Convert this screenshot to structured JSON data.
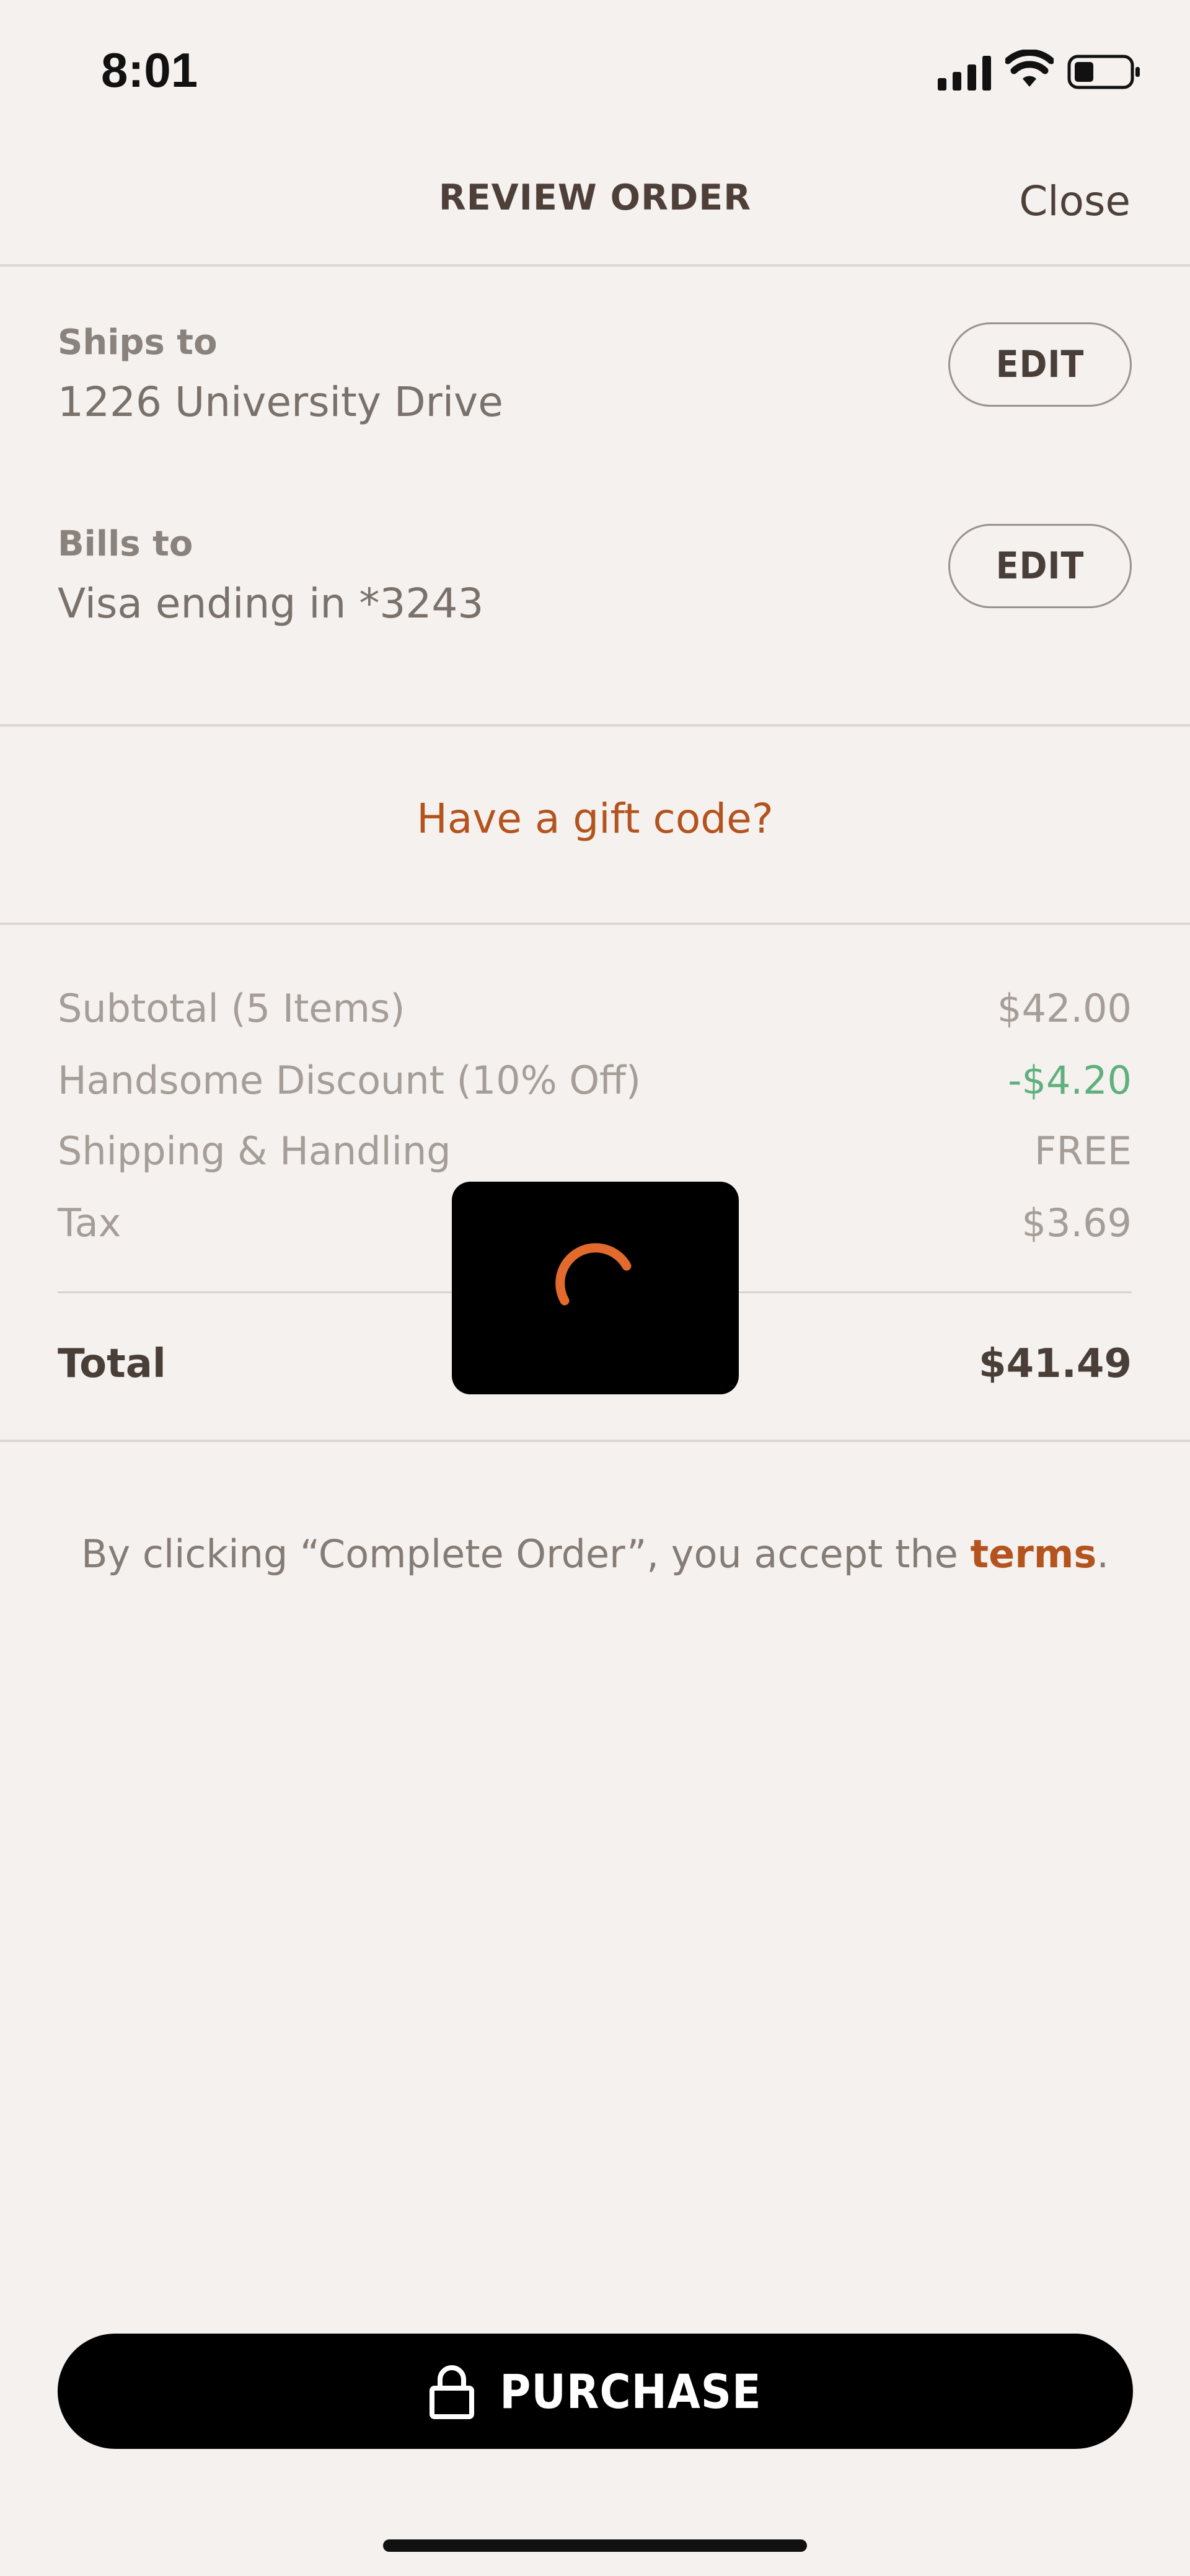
{
  "status_bar": {
    "time": "8:01"
  },
  "header": {
    "title": "REVIEW ORDER",
    "close_label": "Close"
  },
  "shipping": {
    "label": "Ships to",
    "value": "1226 University Drive",
    "edit_label": "EDIT"
  },
  "billing": {
    "label": "Bills to",
    "value": "Visa ending in *3243",
    "edit_label": "EDIT"
  },
  "gift": {
    "link_label": "Have a gift code?"
  },
  "summary": {
    "rows": [
      {
        "label": "Subtotal (5 Items)",
        "value": "$42.00"
      },
      {
        "label": "Handsome Discount (10% Off)",
        "value": "-$4.20"
      },
      {
        "label": "Shipping & Handling",
        "value": "FREE"
      },
      {
        "label": "Tax",
        "value": "$3.69"
      }
    ],
    "total_label": "Total",
    "total_value": "$41.49"
  },
  "terms": {
    "prefix": "By clicking “Complete Order”, you accept the ",
    "link": "terms",
    "suffix": "."
  },
  "purchase": {
    "label": "PURCHASE"
  },
  "colors": {
    "accent": "#b4531e",
    "discount": "#5fb07c",
    "spinner": "#e26a2c",
    "background": "#f4f1ef"
  },
  "icons": {
    "lock": "lock-icon",
    "spinner": "loading-spinner-icon"
  }
}
